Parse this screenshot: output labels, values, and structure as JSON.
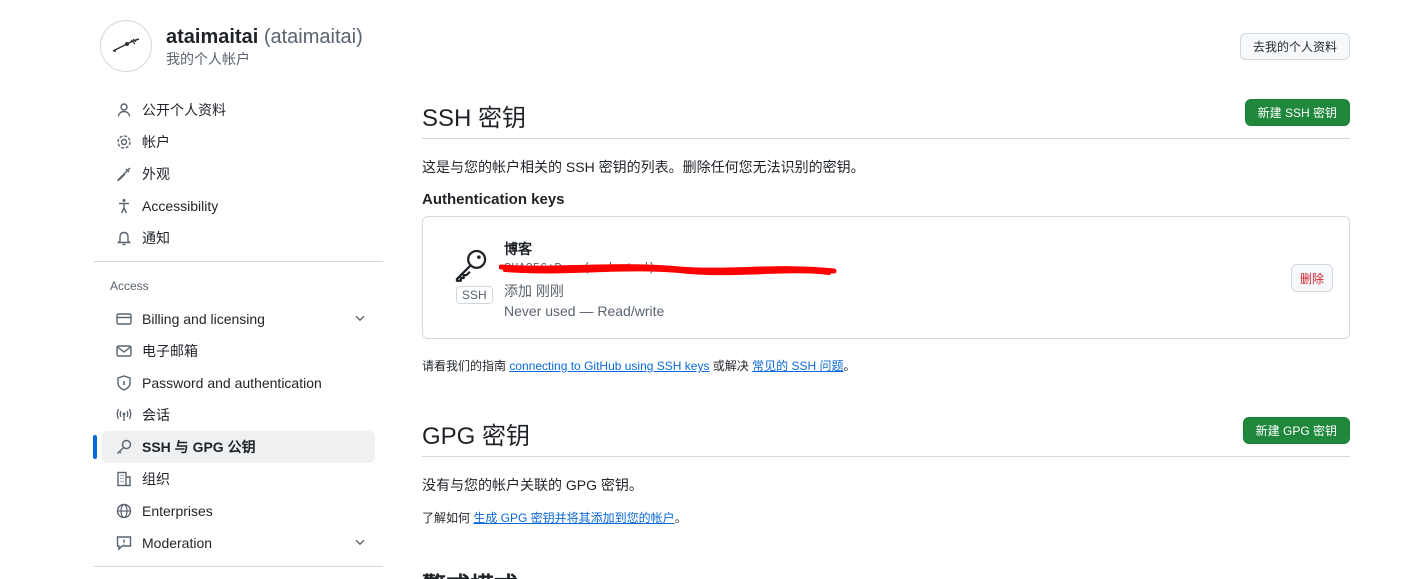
{
  "profile": {
    "name": "ataimaitai",
    "login": "(ataimaitai)",
    "subtitle": "我的个人帐户",
    "go_profile_button": "去我的个人资料"
  },
  "sidebar": {
    "items": [
      {
        "label": "公开个人资料",
        "icon": "person-icon"
      },
      {
        "label": "帐户",
        "icon": "gear-icon"
      },
      {
        "label": "外观",
        "icon": "paintbrush-icon"
      },
      {
        "label": "Accessibility",
        "icon": "accessibility-icon"
      },
      {
        "label": "通知",
        "icon": "bell-icon"
      }
    ],
    "access_heading": "Access",
    "access_items": [
      {
        "label": "Billing and licensing",
        "icon": "credit-card-icon",
        "expandable": true
      },
      {
        "label": "电子邮箱",
        "icon": "mail-icon"
      },
      {
        "label": "Password and authentication",
        "icon": "shield-lock-icon"
      },
      {
        "label": "会话",
        "icon": "broadcast-icon"
      },
      {
        "label": "SSH 与 GPG 公钥",
        "icon": "key-icon",
        "active": true
      },
      {
        "label": "组织",
        "icon": "organization-icon"
      },
      {
        "label": "Enterprises",
        "icon": "globe-icon"
      },
      {
        "label": "Moderation",
        "icon": "report-icon",
        "expandable": true
      }
    ]
  },
  "ssh": {
    "title": "SSH 密钥",
    "new_button": "新建 SSH 密钥",
    "description": "这是与您的帐户相关的 SSH 密钥的列表。删除任何您无法识别的密钥。",
    "auth_heading": "Authentication keys",
    "key": {
      "badge": "SSH",
      "title": "博客",
      "fingerprint": "SHA256:P...(redacted)",
      "added": "添加 刚刚",
      "usage": "Never used — Read/write",
      "delete_button": "删除"
    },
    "help_prefix": "请看我们的指南 ",
    "help_link1": "connecting to GitHub using SSH keys",
    "help_middle": " 或解决 ",
    "help_link2": "常见的 SSH 问题",
    "help_suffix": "。"
  },
  "gpg": {
    "title": "GPG 密钥",
    "new_button": "新建 GPG 密钥",
    "description": "没有与您的帐户关联的 GPG 密钥。",
    "help_prefix": "了解如何 ",
    "help_link": "生成 GPG 密钥并将其添加到您的帐户",
    "help_suffix": "。"
  },
  "vigilant": {
    "title": "警戒模式"
  },
  "colors": {
    "primary": "#1f883d",
    "link": "#0969da",
    "danger": "#d1242f",
    "active_indicator": "#0969da"
  }
}
